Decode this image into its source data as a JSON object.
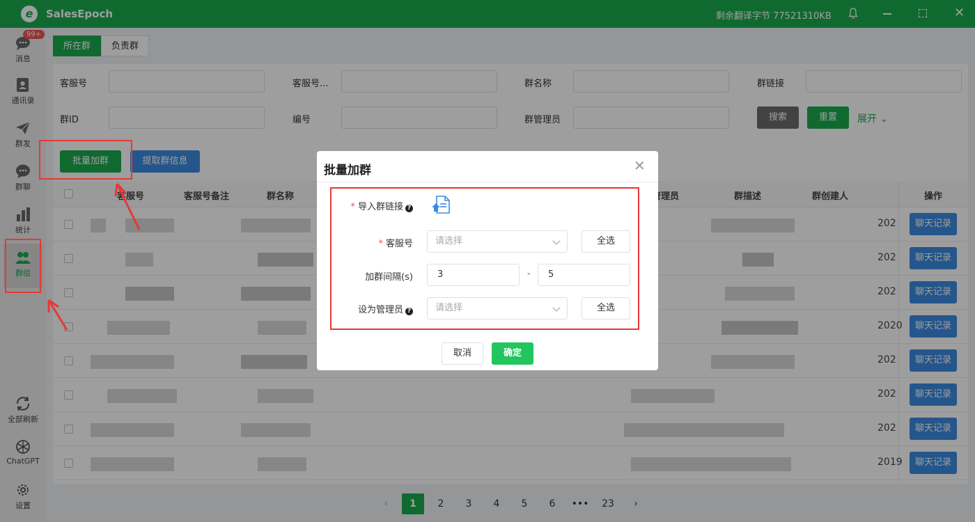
{
  "app": {
    "name": "SalesEpoch",
    "quota_text": "剩余翻译字节 77521310KB"
  },
  "sidebar": {
    "items": [
      {
        "label": "消息",
        "icon": "message-icon",
        "badge": "99+"
      },
      {
        "label": "通讯录",
        "icon": "contacts-icon"
      },
      {
        "label": "群发",
        "icon": "send-icon"
      },
      {
        "label": "群聊",
        "icon": "chat-bubble-icon"
      },
      {
        "label": "统计",
        "icon": "bar-chart-icon"
      },
      {
        "label": "群组",
        "icon": "group-icon"
      },
      {
        "label": "全部刷新",
        "icon": "refresh-icon"
      },
      {
        "label": "ChatGPT",
        "icon": "chatgpt-icon"
      },
      {
        "label": "设置",
        "icon": "gear-icon"
      }
    ]
  },
  "tabs": [
    "所在群",
    "负责群"
  ],
  "filters": {
    "labels": [
      "客服号",
      "客服号...",
      "群名称",
      "群链接",
      "群ID",
      "编号",
      "群管理员"
    ],
    "search": "搜索",
    "reset": "重置",
    "expand": "展开"
  },
  "actions": {
    "batch_join": "批量加群",
    "fetch_info": "提取群信息"
  },
  "table": {
    "headers": [
      "客服号",
      "客服号备注",
      "群名称",
      "管理员",
      "群描述",
      "群创建人",
      "操作"
    ],
    "years": [
      "202",
      "202",
      "202",
      "2020",
      "202",
      "202",
      "202",
      "2019"
    ],
    "row_action": "聊天记录"
  },
  "pagination": {
    "pages": [
      "1",
      "2",
      "3",
      "4",
      "5",
      "6",
      "•••",
      "23"
    ],
    "current": "1"
  },
  "modal": {
    "title": "批量加群",
    "import_label": "导入群链接",
    "agent_label": "客服号",
    "agent_placeholder": "请选择",
    "select_all": "全选",
    "interval_label": "加群间隔(s)",
    "interval_min": "3",
    "interval_sep": "-",
    "interval_max": "5",
    "admin_label": "设为管理员",
    "admin_placeholder": "请选择",
    "cancel": "取消",
    "confirm": "确定"
  },
  "colors": {
    "brand": "#1aac4e",
    "blue": "#3c8be0",
    "annotation": "#e53935"
  }
}
